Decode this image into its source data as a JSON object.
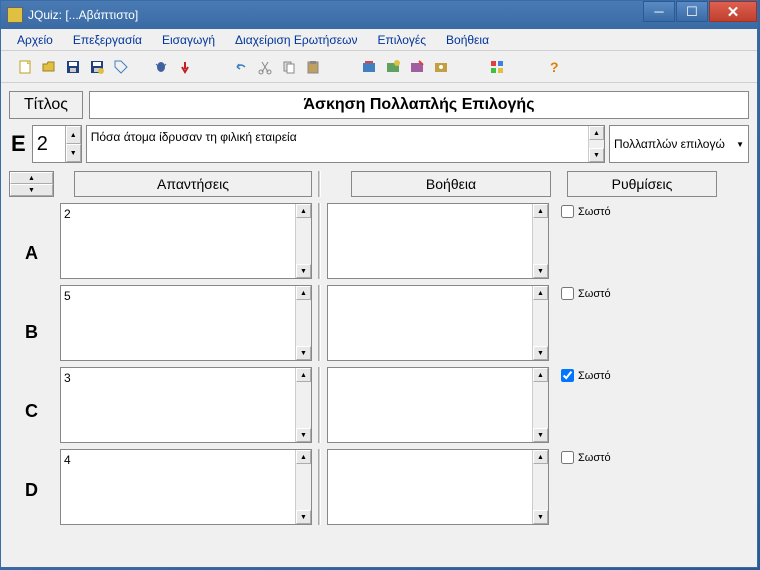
{
  "window": {
    "title": "JQuiz: [...Αβάπτιστο]"
  },
  "menu": {
    "file": "Αρχείο",
    "edit": "Επεξεργασία",
    "insert": "Εισαγωγή",
    "manage": "Διαχείριση Ερωτήσεων",
    "options": "Επιλογές",
    "help": "Βοήθεια"
  },
  "title_label": "Τίτλος",
  "title_value": "Άσκηση Πολλαπλής Επιλογής",
  "question": {
    "label": "Ε",
    "number": "2",
    "text": "Πόσα άτομα ίδρυσαν τη φιλική εταιρεία",
    "type": "Πολλαπλών επιλογώ"
  },
  "columns": {
    "answers": "Απαντήσεις",
    "help": "Βοήθεια",
    "settings": "Ρυθμίσεις"
  },
  "correct_label": "Σωστό",
  "rows": [
    {
      "label": "A",
      "answer": "2",
      "help": "",
      "correct": false
    },
    {
      "label": "B",
      "answer": "5",
      "help": "",
      "correct": false
    },
    {
      "label": "C",
      "answer": "3",
      "help": "",
      "correct": true
    },
    {
      "label": "D",
      "answer": "4",
      "help": "",
      "correct": false
    }
  ]
}
